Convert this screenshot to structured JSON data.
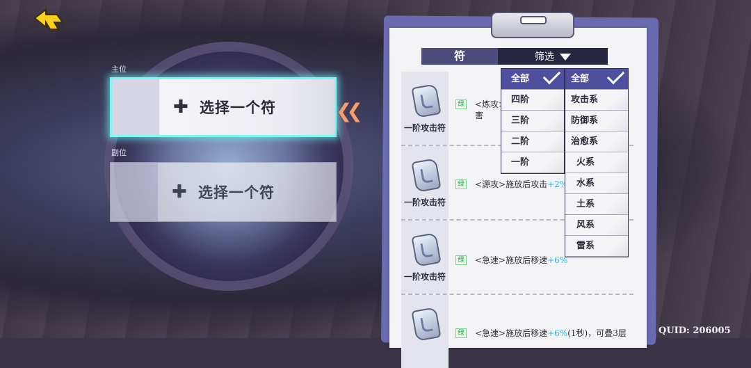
{
  "header": {
    "tab_label": "符",
    "filter_label": "筛选"
  },
  "slots": {
    "primary": {
      "label": "主位",
      "text": "选择一个符"
    },
    "secondary": {
      "label": "副位",
      "text": "选择一个符"
    }
  },
  "list": [
    {
      "name": "一阶攻击符",
      "badge": "绿",
      "desc_a": "<炼攻>",
      "desc_b": "",
      "desc_line2": "害"
    },
    {
      "name": "一阶攻击符",
      "badge": "绿",
      "desc_a": "<源攻>施放后攻击",
      "desc_b": "+2%",
      "desc_line2": ""
    },
    {
      "name": "一阶攻击符",
      "badge": "绿",
      "desc_a": "<急速>施放后移速",
      "desc_b": "+6%",
      "desc_line2": ""
    },
    {
      "name": "",
      "badge": "绿",
      "desc_a": "<急速>施放后移速",
      "desc_b": "+6%",
      "desc_c": "(1秒)，可叠3层",
      "desc_line2": ""
    }
  ],
  "dropdown_tier": [
    "全部",
    "四阶",
    "三阶",
    "二阶",
    "一阶"
  ],
  "dropdown_type": [
    "全部",
    "攻击系",
    "防御系",
    "治愈系",
    "火系",
    "水系",
    "土系",
    "风系",
    "雷系"
  ],
  "quid": "QUID: 206005",
  "colors": {
    "accent": "#7ef6f2",
    "selected": "#4f4fa0",
    "highlight": "#2ab4e8"
  }
}
